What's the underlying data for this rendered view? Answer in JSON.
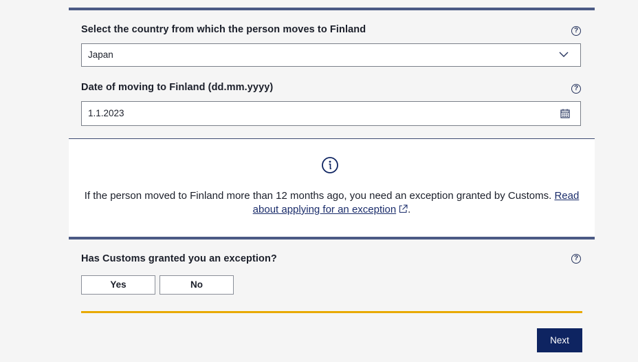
{
  "form": {
    "country": {
      "label": "Select the country from which the person moves to Finland",
      "value": "Japan",
      "help_icon": "help-circle-icon",
      "dropdown_icon": "chevron-down-icon"
    },
    "date": {
      "label": "Date of moving to Finland (dd.mm.yyyy)",
      "value": "1.1.2023",
      "help_icon": "help-circle-icon",
      "calendar_icon": "calendar-icon"
    },
    "info": {
      "icon": "info-icon",
      "text": "If the person moved to Finland more than 12 months ago, you need an exception granted by Customs.",
      "link_text": "Read about applying for an exception",
      "link_suffix": "."
    },
    "exception": {
      "label": "Has Customs granted you an exception?",
      "help_icon": "help-circle-icon",
      "yes_label": "Yes",
      "no_label": "No"
    },
    "next_label": "Next"
  },
  "colors": {
    "accent_bar": "#4b5a85",
    "gold_bar": "#e8a900",
    "primary_button": "#0e2461",
    "link": "#1b2d6b"
  }
}
